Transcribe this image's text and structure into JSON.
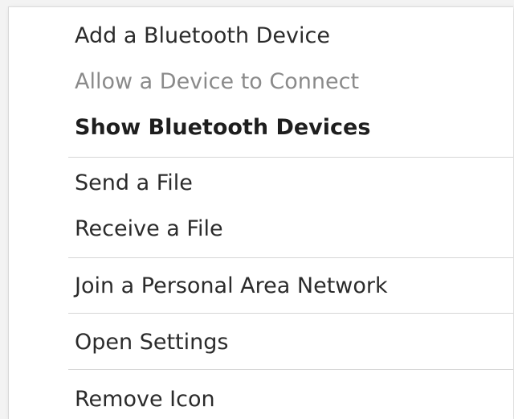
{
  "menu": {
    "items": [
      {
        "label": "Add a Bluetooth Device",
        "state": "enabled"
      },
      {
        "label": "Allow a Device to Connect",
        "state": "disabled"
      },
      {
        "label": "Show Bluetooth Devices",
        "state": "default"
      },
      {
        "label": "Send a File",
        "state": "enabled"
      },
      {
        "label": "Receive a File",
        "state": "enabled"
      },
      {
        "label": "Join a Personal Area Network",
        "state": "enabled"
      },
      {
        "label": "Open Settings",
        "state": "enabled"
      },
      {
        "label": "Remove Icon",
        "state": "enabled"
      }
    ]
  }
}
